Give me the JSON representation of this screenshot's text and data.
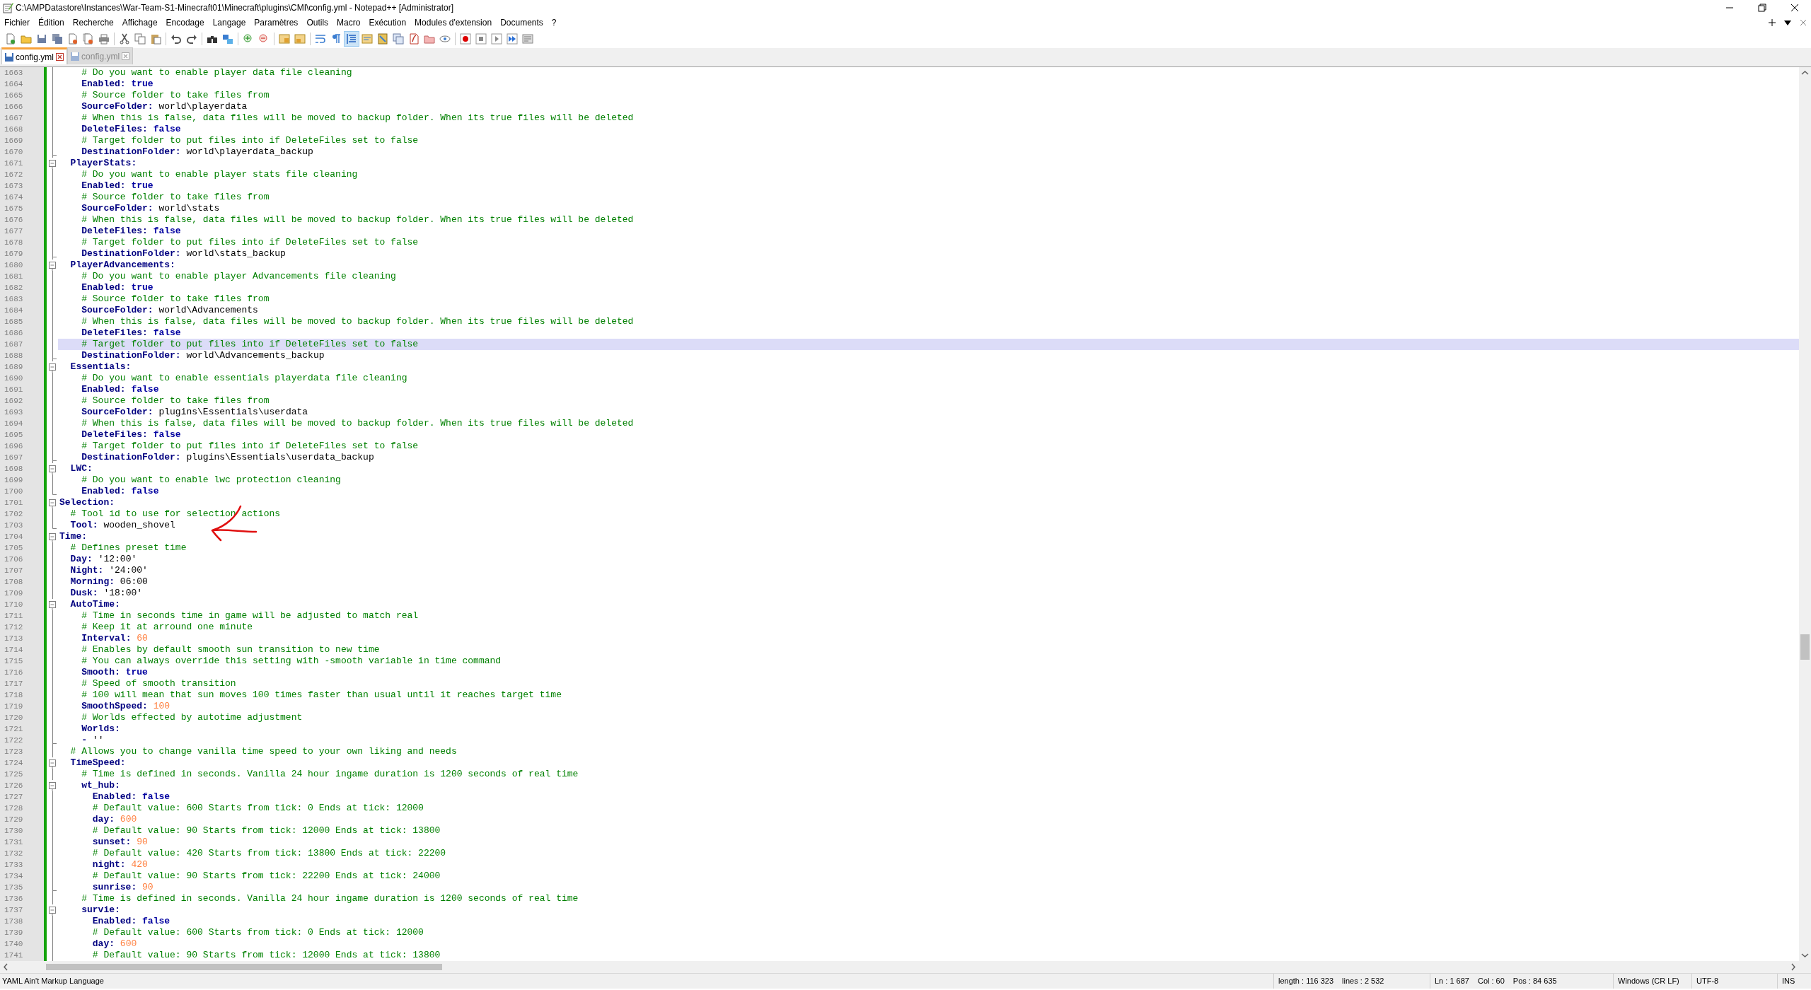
{
  "window": {
    "title": "C:\\AMPDatastore\\Instances\\War-Team-S1-Minecraft01\\Minecraft\\plugins\\CMI\\config.yml - Notepad++ [Administrator]"
  },
  "menu": [
    "Fichier",
    "Édition",
    "Recherche",
    "Affichage",
    "Encodage",
    "Langage",
    "Paramètres",
    "Outils",
    "Macro",
    "Exécution",
    "Modules d'extension",
    "Documents",
    "?"
  ],
  "toolbar": {
    "indent_guide_pressed": true
  },
  "tabs": [
    {
      "label": "config.yml",
      "selected": true
    },
    {
      "label": "config.yml",
      "selected": false
    }
  ],
  "lines": [
    {
      "num": "1663",
      "kind": "line",
      "current": false,
      "parts": [
        {
          "kind": "comment",
          "text": "    # Do you want to enable player data file cleaning"
        }
      ]
    },
    {
      "num": "1664",
      "kind": "line",
      "current": false,
      "parts": [
        {
          "kind": "key",
          "text": "    Enabled:"
        },
        {
          "kind": "bool",
          "text": " true"
        }
      ]
    },
    {
      "num": "1665",
      "kind": "line",
      "current": false,
      "parts": [
        {
          "kind": "comment",
          "text": "    # Source folder to take files from"
        }
      ]
    },
    {
      "num": "1666",
      "kind": "line",
      "current": false,
      "parts": [
        {
          "kind": "key",
          "text": "    SourceFolder:"
        },
        {
          "kind": "value",
          "text": " world\\playerdata"
        }
      ]
    },
    {
      "num": "1667",
      "kind": "line",
      "current": false,
      "parts": [
        {
          "kind": "comment",
          "text": "    # When this is false, data files will be moved to backup folder. When its true files will be deleted"
        }
      ]
    },
    {
      "num": "1668",
      "kind": "line",
      "current": false,
      "parts": [
        {
          "kind": "key",
          "text": "    DeleteFiles:"
        },
        {
          "kind": "bool",
          "text": " false"
        }
      ]
    },
    {
      "num": "1669",
      "kind": "line",
      "current": false,
      "parts": [
        {
          "kind": "comment",
          "text": "    # Target folder to put files into if DeleteFiles set to false"
        }
      ]
    },
    {
      "num": "1670",
      "kind": "tee",
      "current": false,
      "parts": [
        {
          "kind": "key",
          "text": "    DestinationFolder:"
        },
        {
          "kind": "value",
          "text": " world\\playerdata_backup"
        }
      ]
    },
    {
      "num": "1671",
      "kind": "box",
      "current": false,
      "parts": [
        {
          "kind": "key",
          "text": "  PlayerStats:"
        }
      ]
    },
    {
      "num": "1672",
      "kind": "line",
      "current": false,
      "parts": [
        {
          "kind": "comment",
          "text": "    # Do you want to enable player stats file cleaning"
        }
      ]
    },
    {
      "num": "1673",
      "kind": "line",
      "current": false,
      "parts": [
        {
          "kind": "key",
          "text": "    Enabled:"
        },
        {
          "kind": "bool",
          "text": " true"
        }
      ]
    },
    {
      "num": "1674",
      "kind": "line",
      "current": false,
      "parts": [
        {
          "kind": "comment",
          "text": "    # Source folder to take files from"
        }
      ]
    },
    {
      "num": "1675",
      "kind": "line",
      "current": false,
      "parts": [
        {
          "kind": "key",
          "text": "    SourceFolder:"
        },
        {
          "kind": "value",
          "text": " world\\stats"
        }
      ]
    },
    {
      "num": "1676",
      "kind": "line",
      "current": false,
      "parts": [
        {
          "kind": "comment",
          "text": "    # When this is false, data files will be moved to backup folder. When its true files will be deleted"
        }
      ]
    },
    {
      "num": "1677",
      "kind": "line",
      "current": false,
      "parts": [
        {
          "kind": "key",
          "text": "    DeleteFiles:"
        },
        {
          "kind": "bool",
          "text": " false"
        }
      ]
    },
    {
      "num": "1678",
      "kind": "line",
      "current": false,
      "parts": [
        {
          "kind": "comment",
          "text": "    # Target folder to put files into if DeleteFiles set to false"
        }
      ]
    },
    {
      "num": "1679",
      "kind": "tee",
      "current": false,
      "parts": [
        {
          "kind": "key",
          "text": "    DestinationFolder:"
        },
        {
          "kind": "value",
          "text": " world\\stats_backup"
        }
      ]
    },
    {
      "num": "1680",
      "kind": "box",
      "current": false,
      "parts": [
        {
          "kind": "key",
          "text": "  PlayerAdvancements:"
        }
      ]
    },
    {
      "num": "1681",
      "kind": "line",
      "current": false,
      "parts": [
        {
          "kind": "comment",
          "text": "    # Do you want to enable player Advancements file cleaning"
        }
      ]
    },
    {
      "num": "1682",
      "kind": "line",
      "current": false,
      "parts": [
        {
          "kind": "key",
          "text": "    Enabled:"
        },
        {
          "kind": "bool",
          "text": " true"
        }
      ]
    },
    {
      "num": "1683",
      "kind": "line",
      "current": false,
      "parts": [
        {
          "kind": "comment",
          "text": "    # Source folder to take files from"
        }
      ]
    },
    {
      "num": "1684",
      "kind": "line",
      "current": false,
      "parts": [
        {
          "kind": "key",
          "text": "    SourceFolder:"
        },
        {
          "kind": "value",
          "text": " world\\Advancements"
        }
      ]
    },
    {
      "num": "1685",
      "kind": "line",
      "current": false,
      "parts": [
        {
          "kind": "comment",
          "text": "    # When this is false, data files will be moved to backup folder. When its true files will be deleted"
        }
      ]
    },
    {
      "num": "1686",
      "kind": "line",
      "current": false,
      "parts": [
        {
          "kind": "key",
          "text": "    DeleteFiles:"
        },
        {
          "kind": "bool",
          "text": " false"
        }
      ]
    },
    {
      "num": "1687",
      "kind": "line",
      "current": true,
      "parts": [
        {
          "kind": "comment",
          "text": "    # Target folder to put files into if DeleteFiles set to false"
        }
      ]
    },
    {
      "num": "1688",
      "kind": "tee",
      "current": false,
      "parts": [
        {
          "kind": "key",
          "text": "    DestinationFolder:"
        },
        {
          "kind": "value",
          "text": " world\\Advancements_backup"
        }
      ]
    },
    {
      "num": "1689",
      "kind": "box",
      "current": false,
      "parts": [
        {
          "kind": "key",
          "text": "  Essentials:"
        }
      ]
    },
    {
      "num": "1690",
      "kind": "line",
      "current": false,
      "parts": [
        {
          "kind": "comment",
          "text": "    # Do you want to enable essentials playerdata file cleaning"
        }
      ]
    },
    {
      "num": "1691",
      "kind": "line",
      "current": false,
      "parts": [
        {
          "kind": "key",
          "text": "    Enabled:"
        },
        {
          "kind": "bool",
          "text": " false"
        }
      ]
    },
    {
      "num": "1692",
      "kind": "line",
      "current": false,
      "parts": [
        {
          "kind": "comment",
          "text": "    # Source folder to take files from"
        }
      ]
    },
    {
      "num": "1693",
      "kind": "line",
      "current": false,
      "parts": [
        {
          "kind": "key",
          "text": "    SourceFolder:"
        },
        {
          "kind": "value",
          "text": " plugins\\Essentials\\userdata"
        }
      ]
    },
    {
      "num": "1694",
      "kind": "line",
      "current": false,
      "parts": [
        {
          "kind": "comment",
          "text": "    # When this is false, data files will be moved to backup folder. When its true files will be deleted"
        }
      ]
    },
    {
      "num": "1695",
      "kind": "line",
      "current": false,
      "parts": [
        {
          "kind": "key",
          "text": "    DeleteFiles:"
        },
        {
          "kind": "bool",
          "text": " false"
        }
      ]
    },
    {
      "num": "1696",
      "kind": "line",
      "current": false,
      "parts": [
        {
          "kind": "comment",
          "text": "    # Target folder to put files into if DeleteFiles set to false"
        }
      ]
    },
    {
      "num": "1697",
      "kind": "tee",
      "current": false,
      "parts": [
        {
          "kind": "key",
          "text": "    DestinationFolder:"
        },
        {
          "kind": "value",
          "text": " plugins\\Essentials\\userdata_backup"
        }
      ]
    },
    {
      "num": "1698",
      "kind": "box",
      "current": false,
      "parts": [
        {
          "kind": "key",
          "text": "  LWC:"
        }
      ]
    },
    {
      "num": "1699",
      "kind": "line",
      "current": false,
      "parts": [
        {
          "kind": "comment",
          "text": "    # Do you want to enable lwc protection cleaning"
        }
      ]
    },
    {
      "num": "1700",
      "kind": "end",
      "current": false,
      "parts": [
        {
          "kind": "key",
          "text": "    Enabled:"
        },
        {
          "kind": "bool",
          "text": " false"
        }
      ]
    },
    {
      "num": "1701",
      "kind": "box",
      "current": false,
      "parts": [
        {
          "kind": "key",
          "text": "Selection:"
        }
      ]
    },
    {
      "num": "1702",
      "kind": "line",
      "current": false,
      "parts": [
        {
          "kind": "comment",
          "text": "  # Tool id to use for selection actions"
        }
      ]
    },
    {
      "num": "1703",
      "kind": "end",
      "current": false,
      "parts": [
        {
          "kind": "key",
          "text": "  Tool:"
        },
        {
          "kind": "value",
          "text": " wooden_shovel"
        }
      ]
    },
    {
      "num": "1704",
      "kind": "box",
      "current": false,
      "parts": [
        {
          "kind": "key",
          "text": "Time:"
        }
      ]
    },
    {
      "num": "1705",
      "kind": "line",
      "current": false,
      "parts": [
        {
          "kind": "comment",
          "text": "  # Defines preset time"
        }
      ]
    },
    {
      "num": "1706",
      "kind": "line",
      "current": false,
      "parts": [
        {
          "kind": "key",
          "text": "  Day:"
        },
        {
          "kind": "value",
          "text": " '12:00'"
        }
      ]
    },
    {
      "num": "1707",
      "kind": "line",
      "current": false,
      "parts": [
        {
          "kind": "key",
          "text": "  Night:"
        },
        {
          "kind": "value",
          "text": " '24:00'"
        }
      ]
    },
    {
      "num": "1708",
      "kind": "line",
      "current": false,
      "parts": [
        {
          "kind": "key",
          "text": "  Morning:"
        },
        {
          "kind": "value",
          "text": " 06:00"
        }
      ]
    },
    {
      "num": "1709",
      "kind": "line",
      "current": false,
      "parts": [
        {
          "kind": "key",
          "text": "  Dusk:"
        },
        {
          "kind": "value",
          "text": " '18:00'"
        }
      ]
    },
    {
      "num": "1710",
      "kind": "box",
      "current": false,
      "parts": [
        {
          "kind": "key",
          "text": "  AutoTime:"
        }
      ]
    },
    {
      "num": "1711",
      "kind": "line",
      "current": false,
      "parts": [
        {
          "kind": "comment",
          "text": "    # Time in seconds time in game will be adjusted to match real"
        }
      ]
    },
    {
      "num": "1712",
      "kind": "line",
      "current": false,
      "parts": [
        {
          "kind": "comment",
          "text": "    # Keep it at arround one minute"
        }
      ]
    },
    {
      "num": "1713",
      "kind": "line",
      "current": false,
      "parts": [
        {
          "kind": "key",
          "text": "    Interval:"
        },
        {
          "kind": "number",
          "text": " 60"
        }
      ]
    },
    {
      "num": "1714",
      "kind": "line",
      "current": false,
      "parts": [
        {
          "kind": "comment",
          "text": "    # Enables by default smooth sun transition to new time"
        }
      ]
    },
    {
      "num": "1715",
      "kind": "line",
      "current": false,
      "parts": [
        {
          "kind": "comment",
          "text": "    # You can always override this setting with -smooth variable in time command"
        }
      ]
    },
    {
      "num": "1716",
      "kind": "line",
      "current": false,
      "parts": [
        {
          "kind": "key",
          "text": "    Smooth:"
        },
        {
          "kind": "bool",
          "text": " true"
        }
      ]
    },
    {
      "num": "1717",
      "kind": "line",
      "current": false,
      "parts": [
        {
          "kind": "comment",
          "text": "    # Speed of smooth transition"
        }
      ]
    },
    {
      "num": "1718",
      "kind": "line",
      "current": false,
      "parts": [
        {
          "kind": "comment",
          "text": "    # 100 will mean that sun moves 100 times faster than usual until it reaches target time"
        }
      ]
    },
    {
      "num": "1719",
      "kind": "line",
      "current": false,
      "parts": [
        {
          "kind": "key",
          "text": "    SmoothSpeed:"
        },
        {
          "kind": "number",
          "text": " 100"
        }
      ]
    },
    {
      "num": "1720",
      "kind": "line",
      "current": false,
      "parts": [
        {
          "kind": "comment",
          "text": "    # Worlds effected by autotime adjustment"
        }
      ]
    },
    {
      "num": "1721",
      "kind": "line",
      "current": false,
      "parts": [
        {
          "kind": "key",
          "text": "    Worlds:"
        }
      ]
    },
    {
      "num": "1722",
      "kind": "tee",
      "current": false,
      "parts": [
        {
          "kind": "key",
          "text": "    -"
        },
        {
          "kind": "value",
          "text": " ''"
        }
      ]
    },
    {
      "num": "1723",
      "kind": "line",
      "current": false,
      "parts": [
        {
          "kind": "comment",
          "text": "  # Allows you to change vanilla time speed to your own liking and needs"
        }
      ]
    },
    {
      "num": "1724",
      "kind": "box",
      "current": false,
      "parts": [
        {
          "kind": "key",
          "text": "  TimeSpeed:"
        }
      ]
    },
    {
      "num": "1725",
      "kind": "line",
      "current": false,
      "parts": [
        {
          "kind": "comment",
          "text": "    # Time is defined in seconds. Vanilla 24 hour ingame duration is 1200 seconds of real time"
        }
      ]
    },
    {
      "num": "1726",
      "kind": "box",
      "current": false,
      "parts": [
        {
          "kind": "key",
          "text": "    wt_hub:"
        }
      ]
    },
    {
      "num": "1727",
      "kind": "line",
      "current": false,
      "parts": [
        {
          "kind": "key",
          "text": "      Enabled:"
        },
        {
          "kind": "bool",
          "text": " false"
        }
      ]
    },
    {
      "num": "1728",
      "kind": "line",
      "current": false,
      "parts": [
        {
          "kind": "comment",
          "text": "      # Default value: 600 Starts from tick: 0 Ends at tick: 12000"
        }
      ]
    },
    {
      "num": "1729",
      "kind": "line",
      "current": false,
      "parts": [
        {
          "kind": "key",
          "text": "      day:"
        },
        {
          "kind": "number",
          "text": " 600"
        }
      ]
    },
    {
      "num": "1730",
      "kind": "line",
      "current": false,
      "parts": [
        {
          "kind": "comment",
          "text": "      # Default value: 90 Starts from tick: 12000 Ends at tick: 13800"
        }
      ]
    },
    {
      "num": "1731",
      "kind": "line",
      "current": false,
      "parts": [
        {
          "kind": "key",
          "text": "      sunset:"
        },
        {
          "kind": "number",
          "text": " 90"
        }
      ]
    },
    {
      "num": "1732",
      "kind": "line",
      "current": false,
      "parts": [
        {
          "kind": "comment",
          "text": "      # Default value: 420 Starts from tick: 13800 Ends at tick: 22200"
        }
      ]
    },
    {
      "num": "1733",
      "kind": "line",
      "current": false,
      "parts": [
        {
          "kind": "key",
          "text": "      night:"
        },
        {
          "kind": "number",
          "text": " 420"
        }
      ]
    },
    {
      "num": "1734",
      "kind": "line",
      "current": false,
      "parts": [
        {
          "kind": "comment",
          "text": "      # Default value: 90 Starts from tick: 22200 Ends at tick: 24000"
        }
      ]
    },
    {
      "num": "1735",
      "kind": "tee",
      "current": false,
      "parts": [
        {
          "kind": "key",
          "text": "      sunrise:"
        },
        {
          "kind": "number",
          "text": " 90"
        }
      ]
    },
    {
      "num": "1736",
      "kind": "line",
      "current": false,
      "parts": [
        {
          "kind": "comment",
          "text": "    # Time is defined in seconds. Vanilla 24 hour ingame duration is 1200 seconds of real time"
        }
      ]
    },
    {
      "num": "1737",
      "kind": "box",
      "current": false,
      "parts": [
        {
          "kind": "key",
          "text": "    survie:"
        }
      ]
    },
    {
      "num": "1738",
      "kind": "line",
      "current": false,
      "parts": [
        {
          "kind": "key",
          "text": "      Enabled:"
        },
        {
          "kind": "bool",
          "text": " false"
        }
      ]
    },
    {
      "num": "1739",
      "kind": "line",
      "current": false,
      "parts": [
        {
          "kind": "comment",
          "text": "      # Default value: 600 Starts from tick: 0 Ends at tick: 12000"
        }
      ]
    },
    {
      "num": "1740",
      "kind": "line",
      "current": false,
      "parts": [
        {
          "kind": "key",
          "text": "      day:"
        },
        {
          "kind": "number",
          "text": " 600"
        }
      ]
    },
    {
      "num": "1741",
      "kind": "line",
      "current": false,
      "parts": [
        {
          "kind": "comment",
          "text": "      # Default value: 90 Starts from tick: 12000 Ends at tick: 13800"
        }
      ]
    }
  ],
  "status_bar": {
    "language": "YAML Ain't Markup Language",
    "length": "length : 116 323",
    "lines": "lines : 2 532",
    "ln": "Ln : 1 687",
    "col": "Col : 60",
    "pos": "Pos : 84 635",
    "eol": "Windows (CR LF)",
    "encoding": "UTF-8",
    "mode": "INS"
  }
}
